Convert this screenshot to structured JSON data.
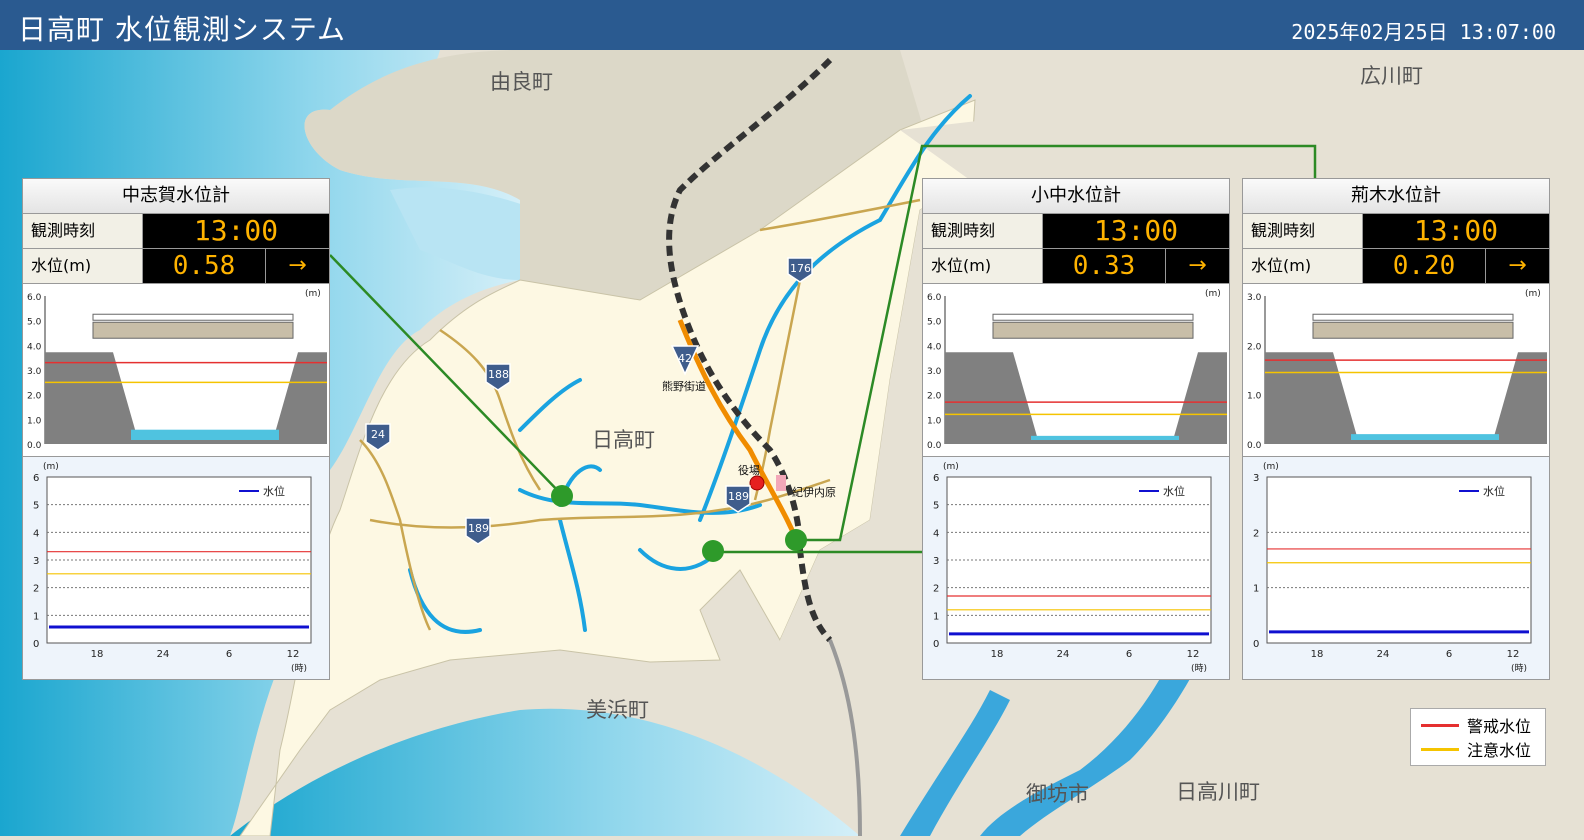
{
  "header": {
    "title": "日高町 水位観測システム",
    "datetime": "2025年02月25日 13:07:00"
  },
  "map": {
    "labels": {
      "yura": "由良町",
      "hirogawa": "広川町",
      "hidaka": "日高町",
      "mihama": "美浜町",
      "gobo": "御坊市",
      "hidakagawa": "日高川町",
      "kumano_kaido": "熊野街道",
      "yakuba": "役場",
      "kii_uchihara": "紀伊内原"
    },
    "routes": [
      "42",
      "176",
      "188",
      "24",
      "189",
      "189"
    ]
  },
  "labels": {
    "obs_time": "観測時刻",
    "level_unit": "水位(m)",
    "unit_m": "(m)",
    "unit_hour": "(時)",
    "legend_level": "水位"
  },
  "hour_ticks": [
    "18",
    "24",
    "6",
    "12"
  ],
  "legend": {
    "warning": "警戒水位",
    "caution": "注意水位",
    "warning_color": "#e53030",
    "caution_color": "#f5c400"
  },
  "gauges": [
    {
      "name": "中志賀水位計",
      "time": "13:00",
      "level": "0.58",
      "trend": "→",
      "level_value": 0.58,
      "section_ticks": [
        "6.0",
        "5.0",
        "4.0",
        "3.0",
        "2.0",
        "1.0",
        "0.0"
      ],
      "section_max": 6,
      "graph_ticks": [
        "6",
        "5",
        "4",
        "3",
        "2",
        "1",
        "0"
      ],
      "graph_max": 6,
      "warning": 3.3,
      "caution": 2.5
    },
    {
      "name": "小中水位計",
      "time": "13:00",
      "level": "0.33",
      "trend": "→",
      "level_value": 0.33,
      "section_ticks": [
        "6.0",
        "5.0",
        "4.0",
        "3.0",
        "2.0",
        "1.0",
        "0.0"
      ],
      "section_max": 6,
      "graph_ticks": [
        "6",
        "5",
        "4",
        "3",
        "2",
        "1",
        "0"
      ],
      "graph_max": 6,
      "warning": 1.7,
      "caution": 1.2
    },
    {
      "name": "荊木水位計",
      "time": "13:00",
      "level": "0.20",
      "trend": "→",
      "level_value": 0.2,
      "section_ticks": [
        "3.0",
        "2.0",
        "1.0",
        "0.0"
      ],
      "section_max": 3,
      "graph_ticks": [
        "3",
        "2",
        "1",
        "0"
      ],
      "graph_max": 3,
      "warning": 1.7,
      "caution": 1.45
    }
  ]
}
